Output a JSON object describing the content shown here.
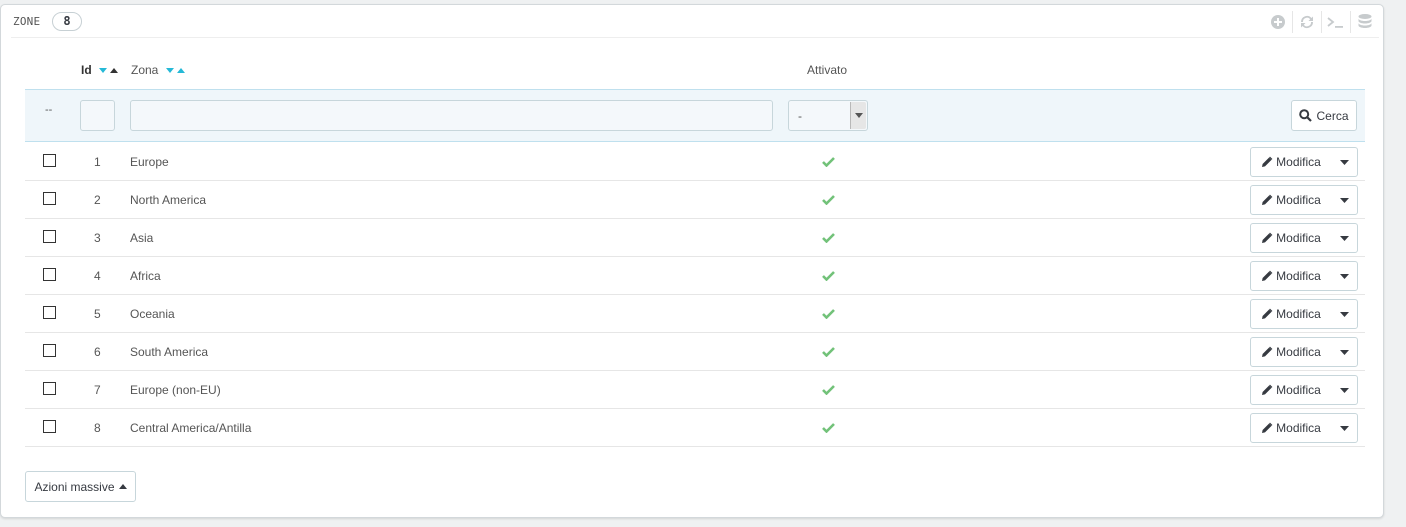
{
  "panel": {
    "title": "ZONE",
    "count": "8",
    "toolbar": [
      {
        "icon": "plus-circle-icon"
      },
      {
        "icon": "refresh-icon"
      },
      {
        "icon": "terminal-icon"
      },
      {
        "icon": "database-icon"
      }
    ]
  },
  "table": {
    "headers": {
      "id": "Id",
      "zona": "Zona",
      "attivato": "Attivato"
    },
    "filter": {
      "placeholder_dash": "--",
      "id_value": "",
      "zona_value": "",
      "attivato_selected": "-",
      "search_label": "Cerca"
    },
    "rows": [
      {
        "id": "1",
        "name": "Europe",
        "active": true,
        "action": "Modifica"
      },
      {
        "id": "2",
        "name": "North America",
        "active": true,
        "action": "Modifica"
      },
      {
        "id": "3",
        "name": "Asia",
        "active": true,
        "action": "Modifica"
      },
      {
        "id": "4",
        "name": "Africa",
        "active": true,
        "action": "Modifica"
      },
      {
        "id": "5",
        "name": "Oceania",
        "active": true,
        "action": "Modifica"
      },
      {
        "id": "6",
        "name": "South America",
        "active": true,
        "action": "Modifica"
      },
      {
        "id": "7",
        "name": "Europe (non-EU)",
        "active": true,
        "action": "Modifica"
      },
      {
        "id": "8",
        "name": "Central America/Antilla",
        "active": true,
        "action": "Modifica"
      }
    ]
  },
  "bulk_actions_label": "Azioni massive",
  "colors": {
    "accent": "#25b9d7",
    "success": "#72c279",
    "filter_bg": "#eff6fa"
  }
}
